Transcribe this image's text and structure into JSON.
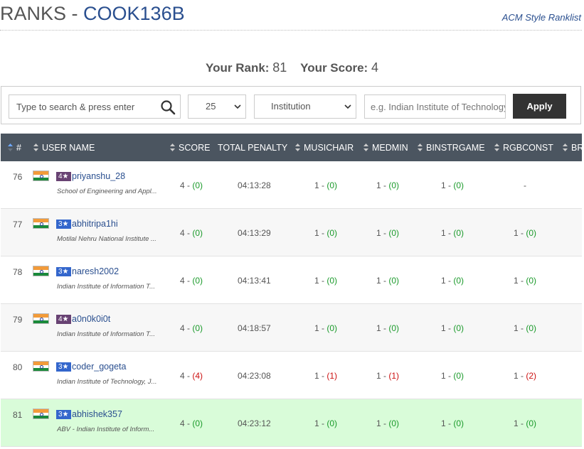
{
  "header": {
    "prefix": "RANKS - ",
    "contest": "COOK136B",
    "ranklist_link": "ACM Style Ranklist"
  },
  "summary": {
    "rank_label": "Your Rank:",
    "rank_value": "81",
    "score_label": "Your Score:",
    "score_value": "4"
  },
  "filters": {
    "search_placeholder": "Type to search & press enter",
    "per_page": "25",
    "filter_type": "Institution",
    "institution_placeholder": "e.g. Indian Institute of Technology",
    "apply_label": "Apply"
  },
  "columns": {
    "rank": "#",
    "user": "USER NAME",
    "score": "SCORE",
    "penalty": "TOTAL PENALTY",
    "p1": "MUSICHAIR",
    "p2": "MEDMIN",
    "p3": "BINSTRGAME",
    "p4": "RGBCONST",
    "p5": "BR"
  },
  "rows": [
    {
      "rank": "76",
      "stars": "4★",
      "username": "priyanshu_28",
      "inst": "School of Engineering and Appl...",
      "score": "4 - ",
      "score_pen": "(0)",
      "time": "04:13:28",
      "p1": "1 - ",
      "p1_pen": "(0)",
      "p2": "1 - ",
      "p2_pen": "(0)",
      "p3": "1 - ",
      "p3_pen": "(0)",
      "p4": "-",
      "p4_pen": ""
    },
    {
      "rank": "77",
      "stars": "3★",
      "username": "abhitripa1hi",
      "inst": "Motilal Nehru National Institute ...",
      "score": "4 - ",
      "score_pen": "(0)",
      "time": "04:13:29",
      "p1": "1 - ",
      "p1_pen": "(0)",
      "p2": "1 - ",
      "p2_pen": "(0)",
      "p3": "1 - ",
      "p3_pen": "(0)",
      "p4": "1 - ",
      "p4_pen": "(0)"
    },
    {
      "rank": "78",
      "stars": "3★",
      "username": "naresh2002",
      "inst": "Indian Institute of Information T...",
      "score": "4 - ",
      "score_pen": "(0)",
      "time": "04:13:41",
      "p1": "1 - ",
      "p1_pen": "(0)",
      "p2": "1 - ",
      "p2_pen": "(0)",
      "p3": "1 - ",
      "p3_pen": "(0)",
      "p4": "1 - ",
      "p4_pen": "(0)"
    },
    {
      "rank": "79",
      "stars": "4★",
      "username": "a0n0k0i0t",
      "inst": "Indian Institute of Information T...",
      "score": "4 - ",
      "score_pen": "(0)",
      "time": "04:18:57",
      "p1": "1 - ",
      "p1_pen": "(0)",
      "p2": "1 - ",
      "p2_pen": "(0)",
      "p3": "1 - ",
      "p3_pen": "(0)",
      "p4": "1 - ",
      "p4_pen": "(0)"
    },
    {
      "rank": "80",
      "stars": "3★",
      "username": "coder_gogeta",
      "inst": "Indian Institute of Technology, J...",
      "score": "4 - ",
      "score_pen": "(4)",
      "time": "04:23:08",
      "p1": "1 - ",
      "p1_pen": "(1)",
      "p2": "1 - ",
      "p2_pen": "(1)",
      "p3": "1 - ",
      "p3_pen": "(0)",
      "p4": "1 - ",
      "p4_pen": "(2)"
    },
    {
      "rank": "81",
      "stars": "3★",
      "username": "abhishek357",
      "inst": "ABV - Indian Institute of Inform...",
      "score": "4 - ",
      "score_pen": "(0)",
      "time": "04:23:12",
      "p1": "1 - ",
      "p1_pen": "(0)",
      "p2": "1 - ",
      "p2_pen": "(0)",
      "p3": "1 - ",
      "p3_pen": "(0)",
      "p4": "1 - ",
      "p4_pen": "(0)"
    }
  ],
  "colors": {
    "header_bg": "#4b5560",
    "link": "#2a4f8f",
    "penalty_zero": "#1a9a2a",
    "penalty_nonzero": "#cc1111",
    "current_user_row": "#d9fcd9",
    "star4": "#684273",
    "star3": "#3366cc"
  }
}
